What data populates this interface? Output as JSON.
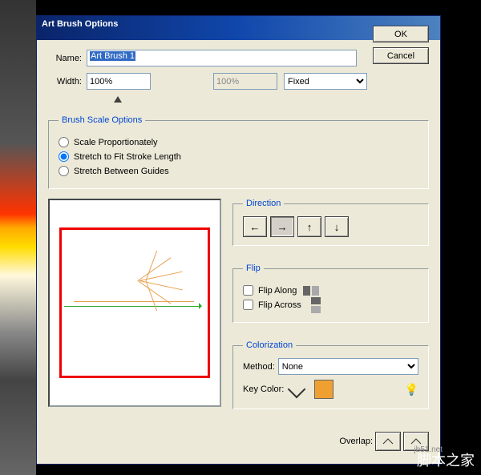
{
  "dialog": {
    "title": "Art Brush Options",
    "name_label": "Name:",
    "name_value": "Art Brush 1",
    "width_label": "Width:",
    "width_value": "100%",
    "width_value2": "100%",
    "mode_options": [
      "Fixed"
    ],
    "mode_selected": "Fixed",
    "ok": "OK",
    "cancel": "Cancel"
  },
  "scale": {
    "legend": "Brush Scale Options",
    "opt1": "Scale Proportionately",
    "opt2": "Stretch to Fit Stroke Length",
    "opt3": "Stretch Between Guides",
    "selected": "opt2"
  },
  "direction": {
    "legend": "Direction",
    "left": "←",
    "right": "→",
    "up": "↑",
    "down": "↓"
  },
  "flip": {
    "legend": "Flip",
    "along": "Flip Along",
    "across": "Flip Across"
  },
  "colorization": {
    "legend": "Colorization",
    "method_label": "Method:",
    "method_value": "None",
    "keycolor_label": "Key Color:",
    "keycolor_hex": "#f0a030",
    "overlap_label": "Overlap:"
  },
  "watermark": {
    "url": "jb51.net",
    "text": "脚本之家"
  }
}
